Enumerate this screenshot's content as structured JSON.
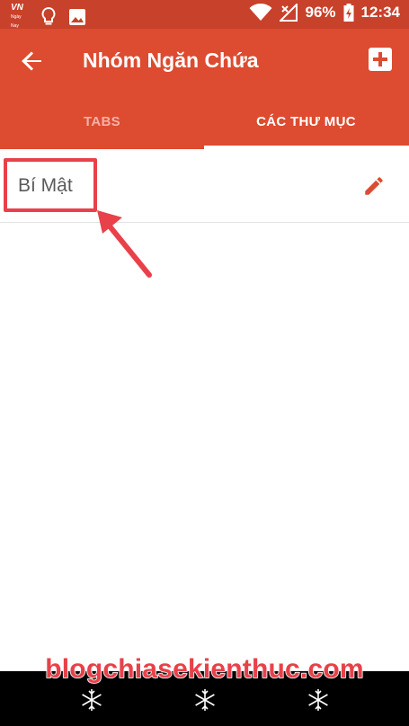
{
  "status_bar": {
    "carrier_logo": "VN",
    "carrier_subtext": "Ngày Nay",
    "battery": "96%",
    "time": "12:34",
    "icons": [
      "lightbulb-icon",
      "image-icon",
      "wifi-icon",
      "signal-icon",
      "battery-icon"
    ]
  },
  "toolbar": {
    "title": "Nhóm Ngăn Chứa",
    "back_icon": "arrow-left-icon",
    "add_icon": "plus-box-icon"
  },
  "tabs": [
    {
      "label": "TABS",
      "selected": false
    },
    {
      "label": "CÁC THƯ MỤC",
      "selected": true
    }
  ],
  "folders": [
    {
      "name": "Bí Mật",
      "action_icon": "pencil-icon"
    }
  ],
  "watermark": "blogchiasekienthuc.com",
  "colors": {
    "toolbar": "#dd4b30",
    "status_bar": "#c8412a",
    "annotation": "#e8414a",
    "edit_icon": "#dd4b30"
  }
}
